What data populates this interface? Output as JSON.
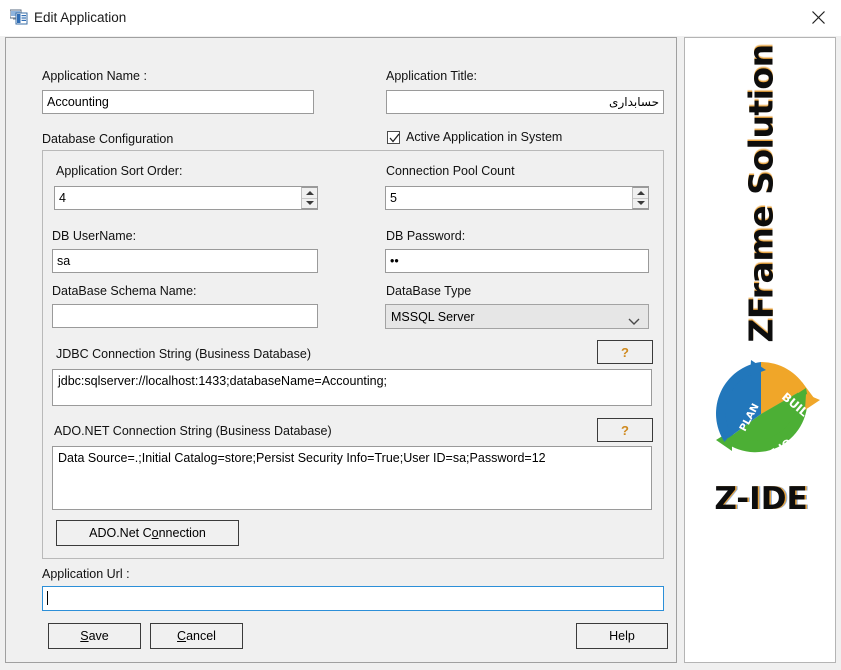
{
  "window": {
    "title": "Edit Application",
    "icon": "application-window-icon",
    "close_icon": "close-icon"
  },
  "form": {
    "application_name_label": "Application  Name :",
    "application_name_value": "Accounting",
    "application_title_label": "Application Title:",
    "application_title_value": "حسابداری",
    "active_checkbox_label": "Active Application in System",
    "active_checkbox_checked": true,
    "database_configuration_label": "Database Configuration",
    "sort_order_label": "Application Sort Order:",
    "sort_order_value": "4",
    "pool_count_label": "Connection Pool Count",
    "pool_count_value": "5",
    "db_username_label": "DB UserName:",
    "db_username_value": "sa",
    "db_password_label": "DB Password:",
    "db_password_value": "••",
    "schema_name_label": "DataBase Schema Name:",
    "schema_name_value": "",
    "database_type_label": "DataBase Type",
    "database_type_value": "MSSQL Server",
    "jdbc_label": "JDBC Connection String (Business Database)",
    "jdbc_value": "jdbc:sqlserver://localhost:1433;databaseName=Accounting;",
    "jdbc_help_label": "?",
    "adonet_label": "ADO.NET Connection String (Business Database)",
    "adonet_value": "Data Source=.;Initial Catalog=store;Persist Security Info=True;User ID=sa;Password=12",
    "adonet_help_label": "?",
    "adonet_connection_button": "ADO.Net Connection",
    "adonet_connection_button_mnemonic": "o",
    "application_url_label": "Application Url :",
    "application_url_value": ""
  },
  "buttons": {
    "save_label": "Save",
    "save_mnemonic": "S",
    "cancel_label": "Cancel",
    "cancel_mnemonic": "C",
    "help_label": "Help"
  },
  "branding": {
    "product_name": "ZFrame Solution",
    "logo_segments": [
      {
        "label": "PLAN",
        "color": "#2277bb"
      },
      {
        "label": "BUILD",
        "color": "#f0a629"
      },
      {
        "label": "OPERATE",
        "color": "#4caf35"
      }
    ],
    "ide_name": "Z-IDE"
  },
  "colors": {
    "accent_orange": "#f0a629",
    "accent_blue": "#2277bb",
    "accent_green": "#4caf35",
    "focus_border": "#2c8fd8",
    "window_bg": "#f0f0f0"
  }
}
